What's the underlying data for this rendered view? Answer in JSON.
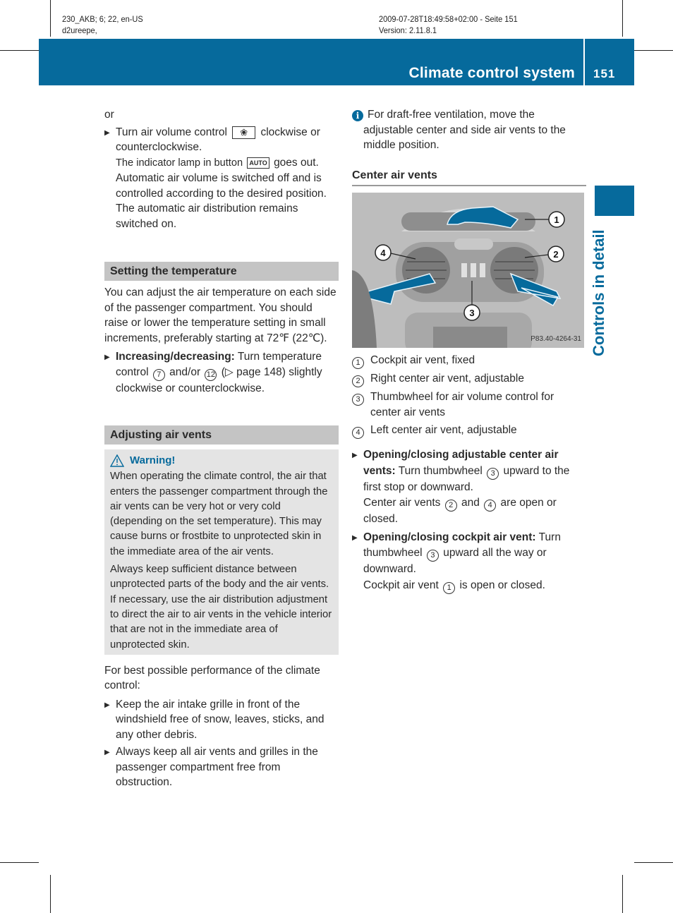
{
  "print_meta": {
    "left_line1": "230_AKB; 6; 22, en-US",
    "left_line2": "d2ureepe,",
    "right_line1": "2009-07-28T18:49:58+02:00 - Seite 151",
    "right_line2": "Version: 2.11.8.1"
  },
  "header": {
    "title": "Climate control system",
    "page_number": "151",
    "accent_color": "#066a9c"
  },
  "side_tab": {
    "label": "Controls in detail"
  },
  "left": {
    "or": "or",
    "air_volume_bullet": {
      "pre": "Turn air volume control",
      "fan_symbol": "fan-icon",
      "post": "clockwise or counterclockwise.",
      "indicator_pre": "The indicator lamp in button",
      "auto_label": "AUTO",
      "indicator_post": "goes out.",
      "rest": "Automatic air volume is switched off and is controlled according to the desired position. The automatic air distribution remains switched on."
    },
    "temperature_section": {
      "heading": "Setting the temperature",
      "intro": "You can adjust the air temperature on each side of the passenger compartment. You should raise or lower the temperature setting in small increments, preferably starting at 72℉ (22℃).",
      "bullet_bold": "Increasing/decreasing:",
      "bullet_pre": "Turn temperature control",
      "ref1": "7",
      "bullet_mid": "and/or",
      "ref2": "12",
      "bullet_post": "(▷ page 148) slightly clockwise or counterclockwise."
    },
    "vents_section": {
      "heading": "Adjusting air vents",
      "warning_title": "Warning!",
      "warning_p1": "When operating the climate control, the air that enters the passenger compartment through the air vents can be very hot or very cold (depending on the set temperature). This may cause burns or frostbite to unprotected skin in the immediate area of the air vents.",
      "warning_p2": "Always keep sufficient distance between unprotected parts of the body and the air vents. If necessary, use the air distribution adjustment to direct the air to air vents in the vehicle interior that are not in the immediate area of unprotected skin.",
      "performance_intro": "For best possible performance of the climate control:",
      "bullets": [
        "Keep the air intake grille in front of the windshield free of snow, leaves, sticks, and any other debris.",
        "Always keep all air vents and grilles in the passenger compartment free from obstruction."
      ]
    }
  },
  "right": {
    "info_note": "For draft-free ventilation, move the adjustable center and side air vents to the middle position.",
    "center_vents_heading": "Center air vents",
    "figure": {
      "code": "P83.40-4264-31",
      "callouts": [
        "1",
        "2",
        "3",
        "4"
      ],
      "description": "Dashboard center air vents with airflow arrows"
    },
    "legend": [
      {
        "num": "1",
        "text": "Cockpit air vent, fixed"
      },
      {
        "num": "2",
        "text": "Right center air vent, adjustable"
      },
      {
        "num": "3",
        "text": "Thumbwheel for air volume control for center air vents"
      },
      {
        "num": "4",
        "text": "Left center air vent, adjustable"
      }
    ],
    "step1": {
      "bold": "Opening/closing adjustable center air vents:",
      "pre": "Turn thumbwheel",
      "ref": "3",
      "post": "upward to the first stop or downward.",
      "result_pre": "Center air vents",
      "result_ref1": "2",
      "result_mid": "and",
      "result_ref2": "4",
      "result_post": "are open or closed."
    },
    "step2": {
      "bold": "Opening/closing cockpit air vent:",
      "pre": "Turn thumbwheel",
      "ref": "3",
      "post": "upward all the way or downward.",
      "result_pre": "Cockpit air vent",
      "result_ref": "1",
      "result_post": "is open or closed."
    }
  }
}
